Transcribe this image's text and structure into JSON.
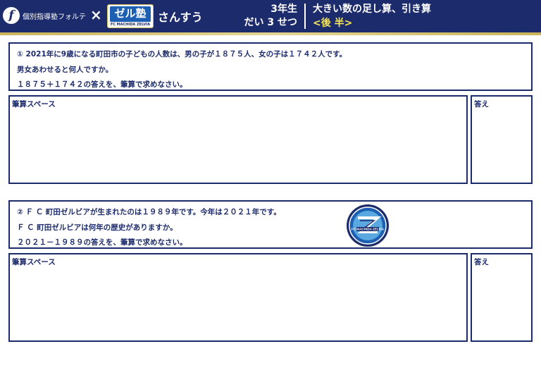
{
  "header": {
    "partner_name": "個別指導塾フォルテ",
    "forte_mark": "f",
    "cross": "×",
    "logo_main": "ゼル塾",
    "logo_sub": "FC MACHIDA ZELVIA",
    "subject": "さんすう",
    "grade_line1": "3年生",
    "grade_line2": "だい 3 せつ",
    "unit_title": "大きい数の足し算、引き算",
    "unit_subtitle": "<後 半>"
  },
  "questions": [
    {
      "lines": [
        "① 2021年に9歳になる町田市の子どもの人数は、男の子が１８７５人、女の子は１７４２人です。",
        "男女あわせると何人ですか。",
        "１８７５＋１７４２の答えを、筆算で求めなさい。"
      ],
      "work_label": "筆算スペース",
      "answer_label": "答え"
    },
    {
      "lines": [
        "② Ｆ Ｃ 町田ゼルビアが生まれたのは１９８９年です。今年は２０２１年です。",
        "Ｆ Ｃ 町田ゼルビアは何年の歴史がありますか。",
        "２０２１－１９８９の答えを、筆算で求めなさい。"
      ],
      "work_label": "筆算スペース",
      "answer_label": "答え"
    }
  ],
  "colors": {
    "navy": "#1c2b6b",
    "gold": "#c9b45a",
    "yellow_text": "#f6e65a",
    "logo_blue": "#1c5fb3"
  },
  "emblem": {
    "icon": "zelvia-emblem-icon",
    "text": "FC MACHIDA ZELVIA"
  }
}
